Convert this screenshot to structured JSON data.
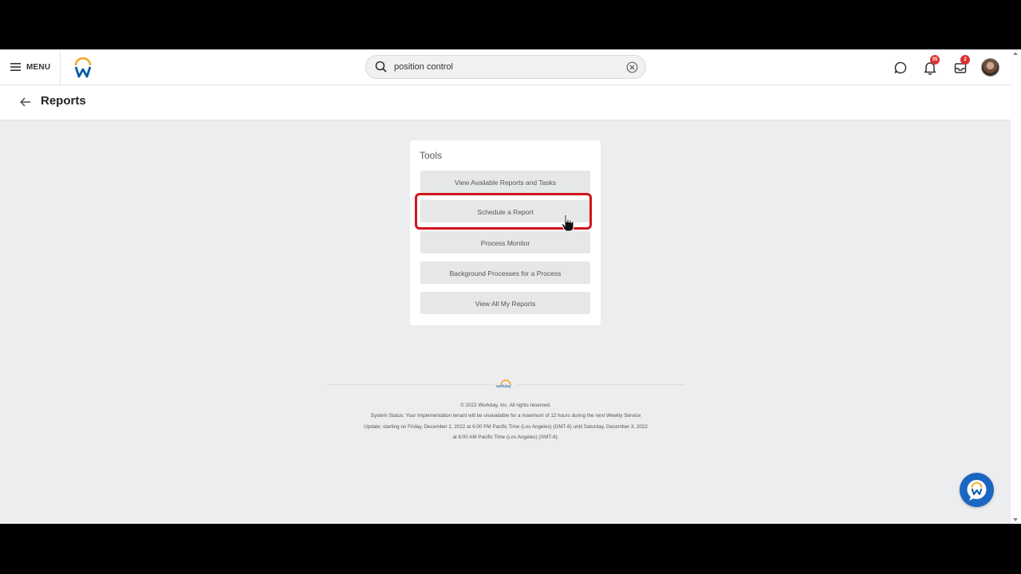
{
  "header": {
    "menu_label": "MENU",
    "search": {
      "value": "position control",
      "placeholder": "Search"
    },
    "notifications_count": "35",
    "inbox_count": "2"
  },
  "page": {
    "title": "Reports"
  },
  "tools": {
    "title": "Tools",
    "items": [
      "View Available Reports and Tasks",
      "Schedule a Report",
      "Process Monitor",
      "Background Processes for a Process",
      "View All My Reports"
    ]
  },
  "footer": {
    "logo_text": "workday",
    "copyright": "© 2022 Workday, Inc. All rights reserved.",
    "status_line1": "System Status: Your Implementation tenant will be unavailable for a maximum of 12 hours during the next Weekly Service",
    "status_line2": "Update; starting on Friday, December 2, 2022 at 6:00 PM Pacific Time (Los Angeles) (GMT-8) until Saturday, December 3, 2022",
    "status_line3": "at 6:00 AM Pacific Time (Los Angeles) (GMT-8)."
  },
  "colors": {
    "brand_blue": "#0a5aa8",
    "brand_orange": "#f5a623",
    "highlight_red": "#d2141c",
    "badge_red": "#d93232",
    "background": "#ecedee"
  }
}
